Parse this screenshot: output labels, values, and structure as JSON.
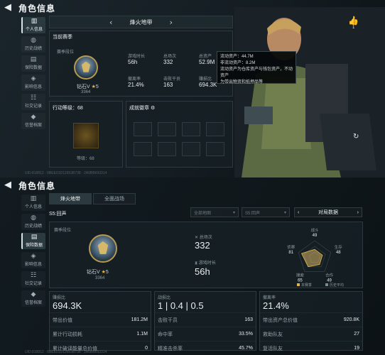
{
  "header": {
    "back_icon": "back-arrow-icon",
    "title": "角色信息"
  },
  "sidebar_top": [
    {
      "label": "个人信息",
      "icon": "chart-icon",
      "active": true
    },
    {
      "label": "历史战绩",
      "icon": "globe-icon",
      "active": false
    },
    {
      "label": "保险数据",
      "icon": "document-icon",
      "active": false
    },
    {
      "label": "影响信息",
      "icon": "tag-icon",
      "active": false
    },
    {
      "label": "社交记录",
      "icon": "people-icon",
      "active": false
    },
    {
      "label": "信誉档案",
      "icon": "shield-icon",
      "active": false
    }
  ],
  "sidebar_bottom": [
    {
      "label": "个人信息",
      "icon": "chart-icon",
      "active": false
    },
    {
      "label": "历史战绩",
      "icon": "globe-icon",
      "active": false
    },
    {
      "label": "保险数据",
      "icon": "document-icon",
      "active": true
    },
    {
      "label": "影响信息",
      "icon": "tag-icon",
      "active": false
    },
    {
      "label": "社交记录",
      "icon": "people-icon",
      "active": false
    },
    {
      "label": "信誉档案",
      "icon": "shield-icon",
      "active": false
    }
  ],
  "top": {
    "map_tab": "烽火地带",
    "season_label": "当前赛季",
    "rank_caption": "赛季段位",
    "rank_name": "钻石V",
    "rank_stars": "5",
    "rank_points": "3364",
    "stats": [
      {
        "label": "游戏时长",
        "value": "56h"
      },
      {
        "label": "总场次",
        "value": "332"
      },
      {
        "label": "总资产",
        "value": "52.9M"
      },
      {
        "label": "撤离率",
        "value": "21.4%"
      },
      {
        "label": "击败干员",
        "value": "163"
      },
      {
        "label": "赚损比",
        "value": "694.3K"
      }
    ],
    "level_label": "行动等级：68",
    "level_caption": "等级：",
    "level_value": "68",
    "achievements_label": "成就徽章",
    "tooltip_lines": [
      "流动资产：44.7M",
      "非流动资产：8.2M",
      "流动资产为仓库资产与钱包资产，不动资产",
      "为带出物资和抵押品等"
    ],
    "like_label": "1",
    "statusbar": "UID:818812 · 6BEE01D12653B738 · 2A0BB693314"
  },
  "bottom": {
    "tabs": [
      "烽火地带",
      "全面战场"
    ],
    "season": "S5:回声",
    "dropdowns": [
      "全部地图",
      "S5:回声",
      "对局数据"
    ],
    "rank_caption": "赛季段位",
    "rank_name": "钻石V",
    "rank_stars": "5",
    "rank_points": "3364",
    "center_stats": [
      {
        "icon": "crossed-swords-icon",
        "label": "总场次",
        "value": "332"
      },
      {
        "icon": "hourglass-icon",
        "label": "游戏时长",
        "value": "56h"
      }
    ],
    "radar": {
      "labels": [
        "战斗",
        "生存",
        "合作",
        "搜索",
        "侦察"
      ],
      "values": [
        49,
        48,
        49,
        65,
        81
      ],
      "legend": [
        "本赛季",
        "历史平均"
      ]
    },
    "col1": {
      "label": "赚损比",
      "big": "694.3K",
      "rows": [
        {
          "k": "带出价值",
          "v": "181.2M"
        },
        {
          "k": "累计行动损耗",
          "v": "1.1M"
        },
        {
          "k": "累计破译能量总价值",
          "v": "0"
        }
      ]
    },
    "col2": {
      "label": "战损比",
      "big_parts": [
        "1",
        "0.4",
        "0.5"
      ],
      "rows": [
        {
          "k": "击败干员",
          "v": "163"
        },
        {
          "k": "命中率",
          "v": "33.5%"
        },
        {
          "k": "精准击杀率",
          "v": "45.7%"
        }
      ]
    },
    "col3": {
      "label": "撤离率",
      "big": "21.4%",
      "rows": [
        {
          "k": "带出资产总价值",
          "v": "920.8K"
        },
        {
          "k": "救助队友",
          "v": "27"
        },
        {
          "k": "复活队友",
          "v": "19"
        }
      ]
    },
    "statusbar": "UID:818812 · 6BEE01D12653B738 · 2A0BB693314"
  },
  "colors": {
    "accent_gold": "#e0b54a",
    "active_sidebar": "#2b3a3f",
    "text": "#c9d2d6",
    "panel_border": "#2d3a40"
  }
}
